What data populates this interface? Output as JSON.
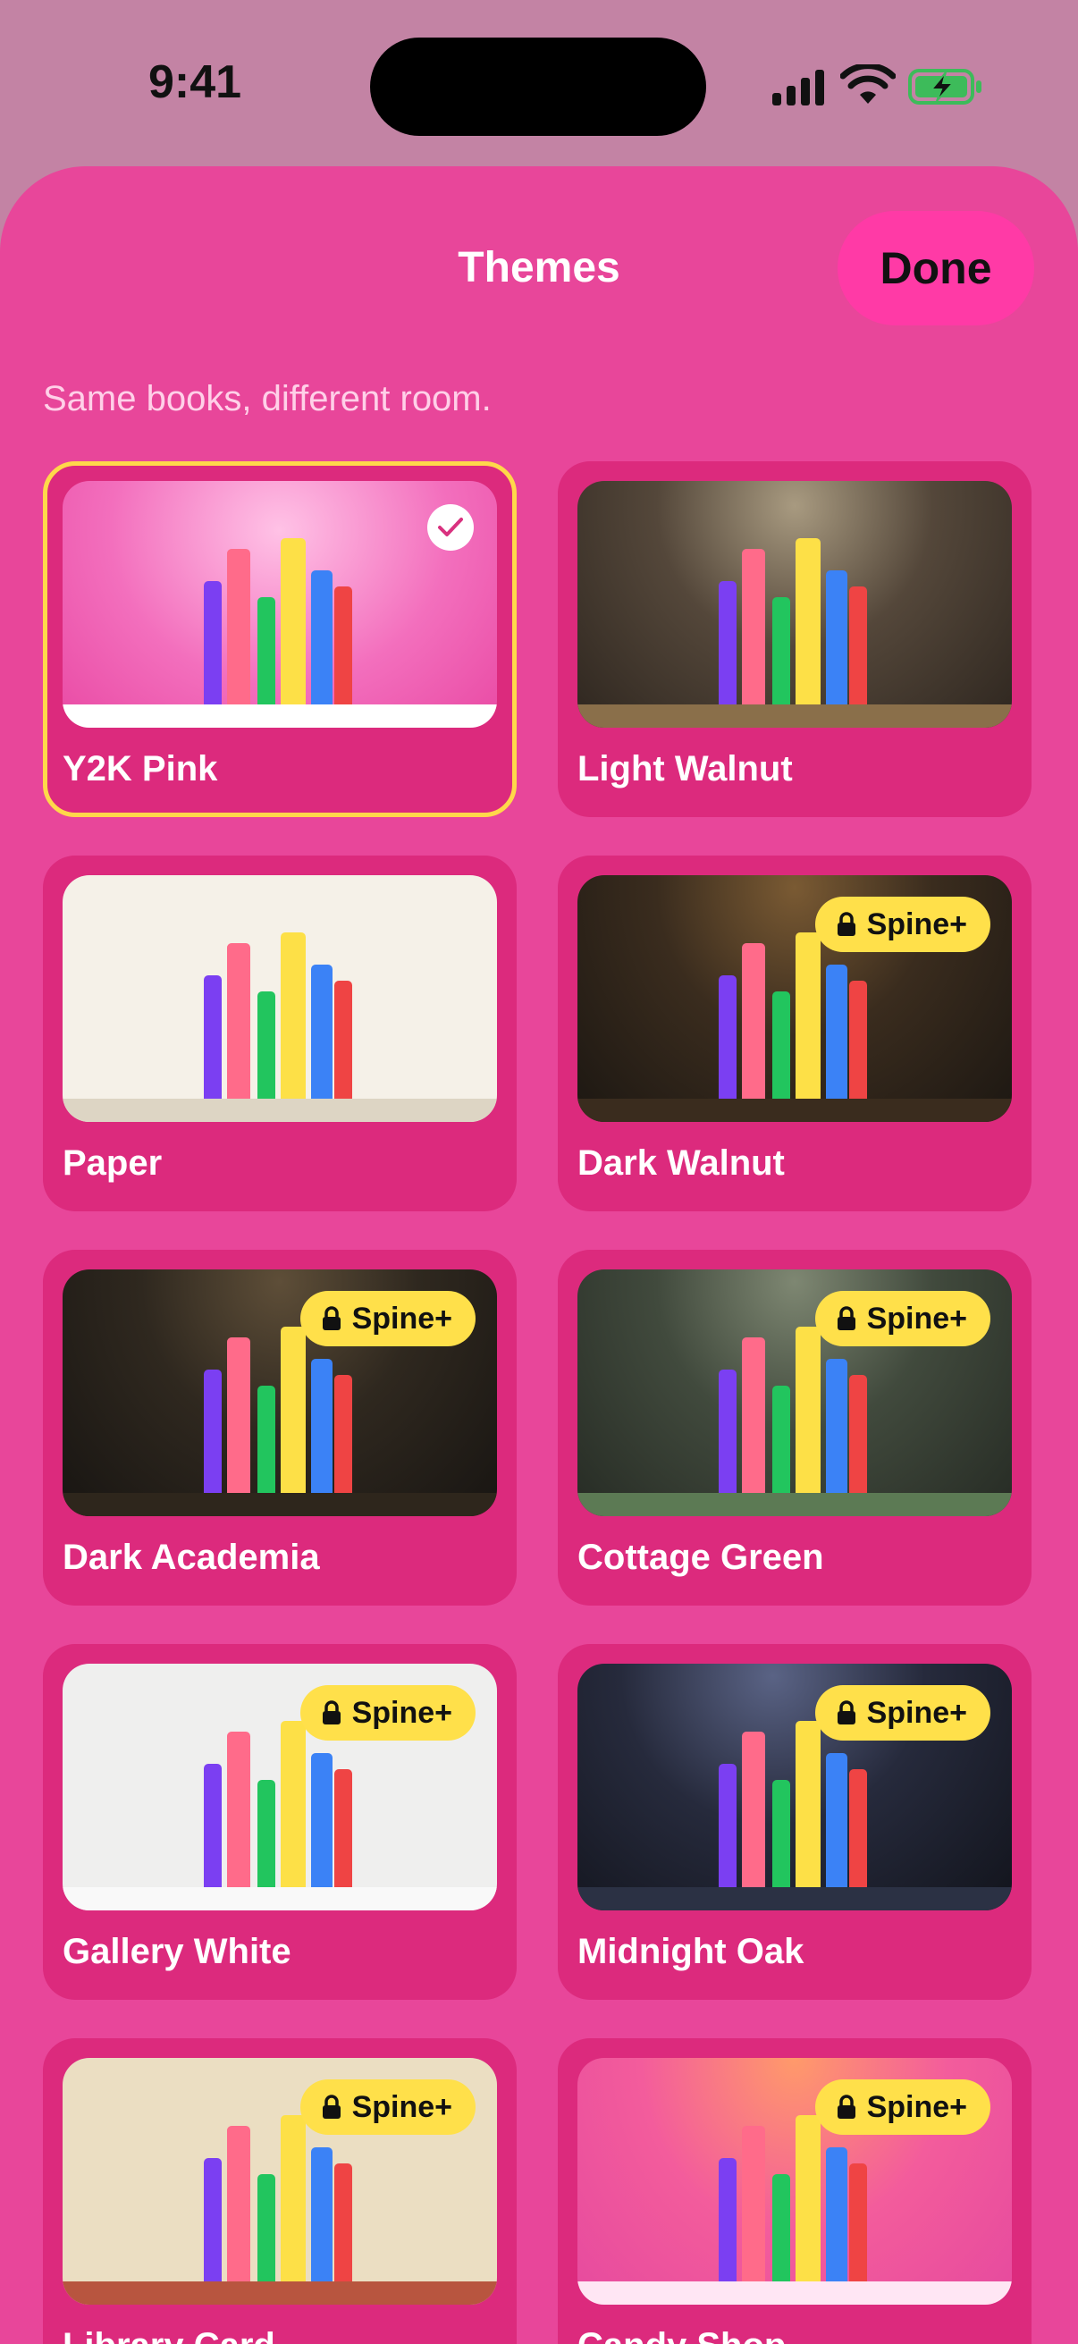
{
  "status_bar": {
    "time": "9:41"
  },
  "sheet": {
    "title": "Themes",
    "done_label": "Done",
    "subtitle": "Same books, different room."
  },
  "book_colors": [
    "#7b3ff2",
    "#ff6b8a",
    "#22c55e",
    "#fde047",
    "#3b82f6",
    "#ef4444"
  ],
  "themes": [
    {
      "name": "Y2K Pink",
      "selected": true,
      "locked": false,
      "badge": "",
      "bg": "radial-gradient(ellipse at 50% 20%, #ffc2e6 0%, #f36fbd 55%, #e94aa4 100%)",
      "shelf": "#ffffff"
    },
    {
      "name": "Light Walnut",
      "selected": false,
      "locked": false,
      "badge": "",
      "bg": "radial-gradient(ellipse at 50% 10%, #a89a80 0%, #54473a 45%, #2e261f 100%)",
      "shelf": "#8a6f4a"
    },
    {
      "name": "Paper",
      "selected": false,
      "locked": false,
      "badge": "",
      "bg": "#f5f1e8",
      "shelf": "#ddd5c4"
    },
    {
      "name": "Dark Walnut",
      "selected": false,
      "locked": true,
      "badge": "Spine+",
      "bg": "radial-gradient(ellipse at 50% 5%, #7a5a33 0%, #3a2c1e 45%, #1c1712 100%)",
      "shelf": "#3a2c1e"
    },
    {
      "name": "Dark Academia",
      "selected": false,
      "locked": true,
      "badge": "Spine+",
      "bg": "radial-gradient(ellipse at 50% 5%, #5e4e38 0%, #2f281f 45%, #181512 100%)",
      "shelf": "#2e261c"
    },
    {
      "name": "Cottage Green",
      "selected": false,
      "locked": true,
      "badge": "Spine+",
      "bg": "radial-gradient(ellipse at 50% 5%, #7e8772 0%, #414a3d 45%, #262b24 100%)",
      "shelf": "#5c7a54"
    },
    {
      "name": "Gallery White",
      "selected": false,
      "locked": true,
      "badge": "Spine+",
      "bg": "#efefee",
      "shelf": "#f9f9f9"
    },
    {
      "name": "Midnight Oak",
      "selected": false,
      "locked": true,
      "badge": "Spine+",
      "bg": "radial-gradient(ellipse at 45% 5%, #5a6385 0%, #262a3c 45%, #12141c 100%)",
      "shelf": "#2b3144"
    },
    {
      "name": "Library Card",
      "selected": false,
      "locked": true,
      "badge": "Spine+",
      "bg": "#ebdec2",
      "shelf": "#b8553f"
    },
    {
      "name": "Candy Shop",
      "selected": false,
      "locked": true,
      "badge": "Spine+",
      "bg": "radial-gradient(ellipse at 50% 0%, #ff9a6a 0%, #f35c9c 50%, #e64a9e 100%)",
      "shelf": "#ffe6f4"
    }
  ]
}
